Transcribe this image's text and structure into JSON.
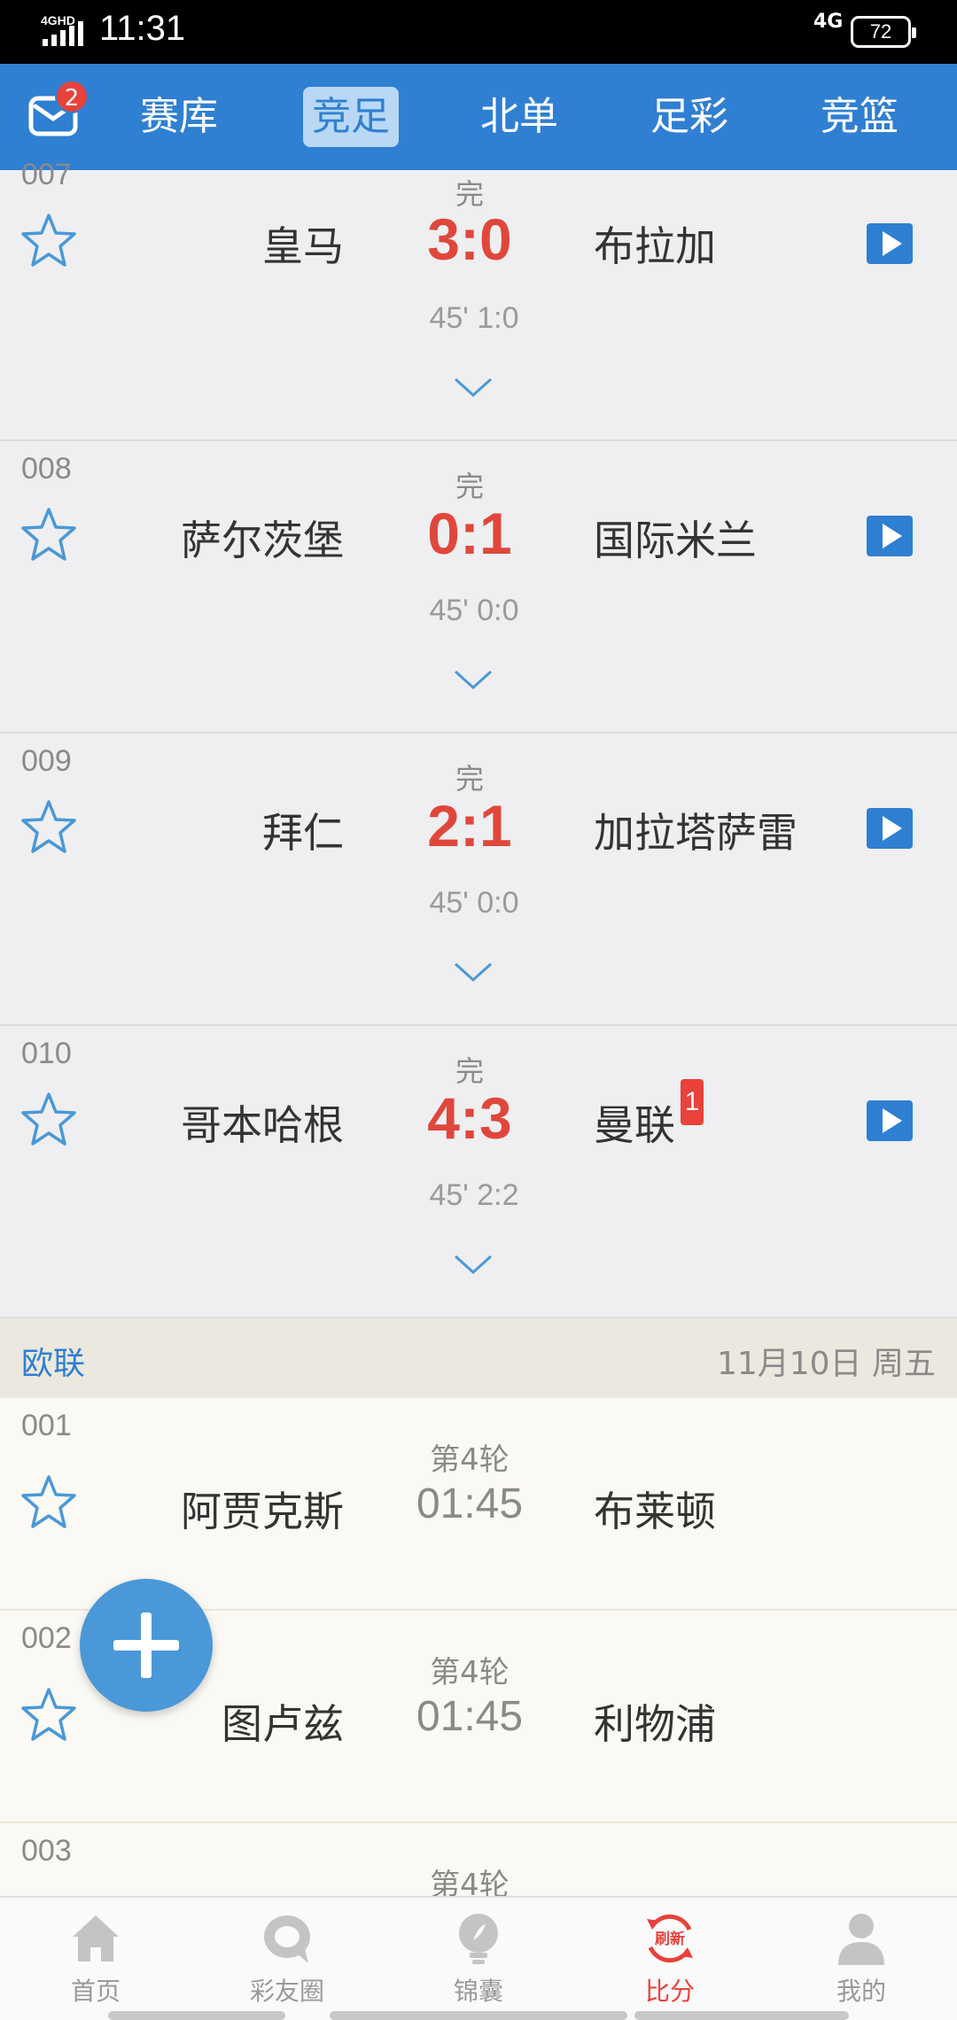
{
  "status_bar": {
    "network_left": "4GHD",
    "time": "11:31",
    "network_right": "4G",
    "battery": "72"
  },
  "top_nav": {
    "mail_badge": "2",
    "tabs": [
      {
        "label": "赛库",
        "active": false
      },
      {
        "label": "竞足",
        "active": true
      },
      {
        "label": "北单",
        "active": false
      },
      {
        "label": "足彩",
        "active": false
      },
      {
        "label": "竞篮",
        "active": false
      }
    ]
  },
  "finished_matches": [
    {
      "num": "007",
      "status": "完",
      "home": "皇马",
      "score": "3:0",
      "away": "布拉加",
      "half": "45' 1:0"
    },
    {
      "num": "008",
      "status": "完",
      "home": "萨尔茨堡",
      "score": "0:1",
      "away": "国际米兰",
      "half": "45' 0:0"
    },
    {
      "num": "009",
      "status": "完",
      "home": "拜仁",
      "score": "2:1",
      "away": "加拉塔萨雷",
      "half": "45' 0:0"
    },
    {
      "num": "010",
      "status": "完",
      "home": "哥本哈根",
      "score": "4:3",
      "away": "曼联",
      "half": "45' 2:2",
      "away_red_cards": "1"
    }
  ],
  "league_section": {
    "name": "欧联",
    "date": "11月10日 周五"
  },
  "upcoming_matches": [
    {
      "num": "001",
      "round": "第4轮",
      "home": "阿贾克斯",
      "time": "01:45",
      "away": "布莱顿"
    },
    {
      "num": "002",
      "round": "第4轮",
      "home": "图卢兹",
      "time": "01:45",
      "away": "利物浦"
    },
    {
      "num": "003",
      "round": "第4轮"
    }
  ],
  "bottom_nav": [
    {
      "label": "首页",
      "icon": "home-icon"
    },
    {
      "label": "彩友圈",
      "icon": "chat-bubble-icon"
    },
    {
      "label": "锦囊",
      "icon": "lightbulb-icon"
    },
    {
      "label": "比分",
      "icon": "refresh-score-icon",
      "active": true,
      "icon_text": "刷新"
    },
    {
      "label": "我的",
      "icon": "user-icon"
    }
  ],
  "colors": {
    "brand_blue": "#2f7fd2",
    "score_red": "#e0473c",
    "badge_red": "#e8423b"
  }
}
